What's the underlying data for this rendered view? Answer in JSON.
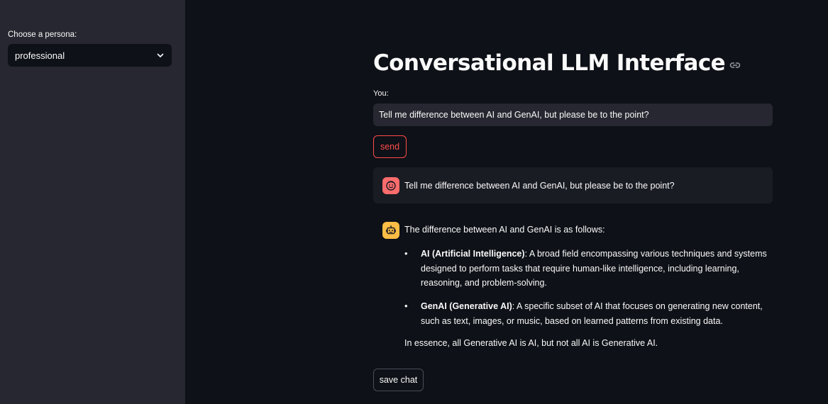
{
  "sidebar": {
    "persona_label": "Choose a persona:",
    "persona_value": "professional"
  },
  "main": {
    "title": "Conversational LLM Interface",
    "input_label": "You:",
    "input_value": "Tell me difference between AI and GenAI, but please be to the point?",
    "send_label": "send",
    "save_label": "save chat"
  },
  "messages": {
    "user": {
      "text": "Tell me difference between AI and GenAI, but please be to the point?",
      "avatar_icon": "smiley-face-icon"
    },
    "assistant": {
      "avatar_icon": "robot-icon",
      "intro": "The difference between AI and GenAI is as follows:",
      "bullets": [
        {
          "term": "AI (Artificial Intelligence)",
          "desc": ": A broad field encompassing various techniques and systems designed to perform tasks that require human-like intelligence, including learning, reasoning, and problem-solving."
        },
        {
          "term": "GenAI (Generative AI)",
          "desc": ": A specific subset of AI that focuses on generating new content, such as text, images, or music, based on learned patterns from existing data."
        }
      ],
      "essence": "In essence, all Generative AI is AI, but not all AI is Generative AI."
    }
  },
  "colors": {
    "background": "#0e1117",
    "sidebar": "#262730",
    "accent": "#ff4b4b",
    "user_avatar": "#ff6c6c",
    "bot_avatar": "#ffbd45"
  }
}
